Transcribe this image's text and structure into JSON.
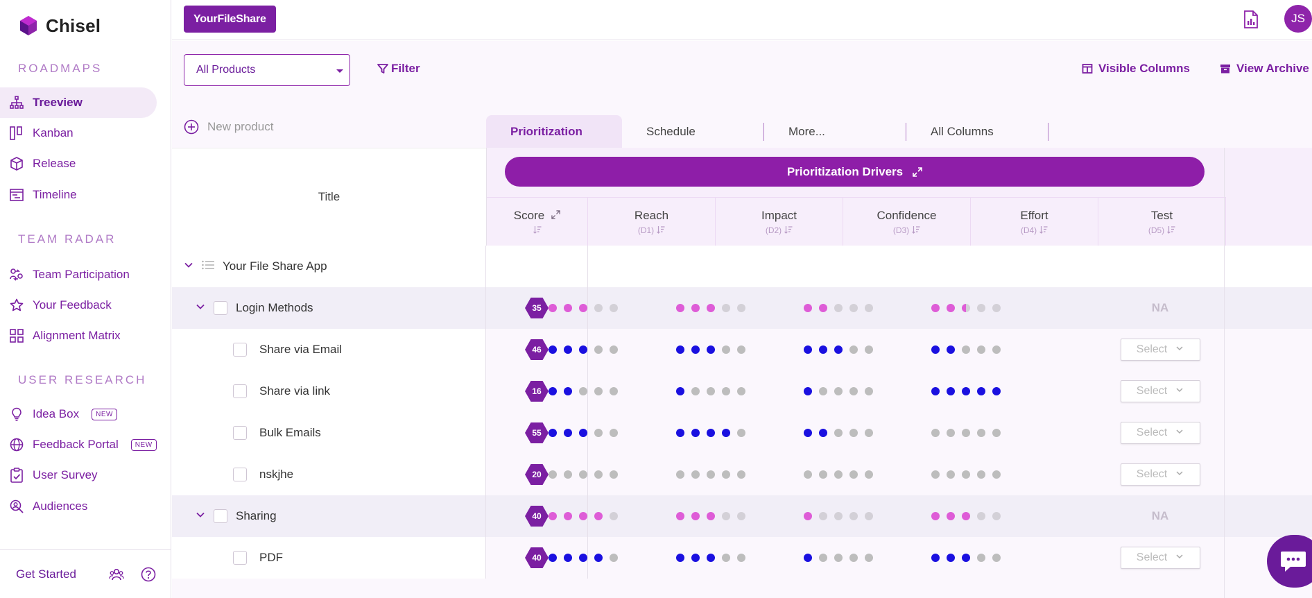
{
  "brand": {
    "name": "Chisel"
  },
  "sidebar": {
    "sections": [
      {
        "title": "ROADMAPS"
      },
      {
        "title": "TEAM RADAR"
      },
      {
        "title": "USER RESEARCH"
      }
    ],
    "roadmaps": [
      {
        "label": "Treeview",
        "icon": "tree-icon",
        "active": true
      },
      {
        "label": "Kanban",
        "icon": "kanban-icon"
      },
      {
        "label": "Release",
        "icon": "box-icon"
      },
      {
        "label": "Timeline",
        "icon": "timeline-icon"
      }
    ],
    "team_radar": [
      {
        "label": "Team Participation",
        "icon": "participation-icon"
      },
      {
        "label": "Your Feedback",
        "icon": "star-icon"
      },
      {
        "label": "Alignment Matrix",
        "icon": "grid-icon"
      }
    ],
    "user_research": [
      {
        "label": "Idea Box",
        "icon": "lightbulb-icon",
        "badge": "NEW"
      },
      {
        "label": "Feedback Portal",
        "icon": "globe-icon",
        "badge": "NEW"
      },
      {
        "label": "User Survey",
        "icon": "clipboard-icon"
      },
      {
        "label": "Audiences",
        "icon": "audience-icon"
      }
    ],
    "bottom": {
      "get_started": "Get Started"
    }
  },
  "topbar": {
    "workspace": "YourFileShare",
    "avatar_initials": "JS"
  },
  "toolbar": {
    "product_select": "All Products",
    "filter": "Filter",
    "visible_columns": "Visible Columns",
    "view_archive": "View Archive"
  },
  "new_product": "New product",
  "tabs": [
    {
      "label": "Prioritization",
      "active": true
    },
    {
      "label": "Schedule"
    },
    {
      "label": "More..."
    },
    {
      "label": "All Columns"
    }
  ],
  "table": {
    "title_header": "Title",
    "drivers_header": "Prioritization Drivers",
    "columns": [
      {
        "label": "Score",
        "sub": ""
      },
      {
        "label": "Reach",
        "sub": "(D1)"
      },
      {
        "label": "Impact",
        "sub": "(D2)"
      },
      {
        "label": "Confidence",
        "sub": "(D3)"
      },
      {
        "label": "Effort",
        "sub": "(D4)"
      },
      {
        "label": "Test",
        "sub": "(D5)"
      }
    ],
    "na_label": "NA",
    "select_label": "Select",
    "rows": [
      {
        "type": "root",
        "title": "Your File Share App"
      },
      {
        "type": "group",
        "title": "Login Methods",
        "score": "35",
        "reach": 3,
        "impact": 3,
        "confidence": 2,
        "effort": 2.5,
        "test": "NA"
      },
      {
        "type": "child",
        "title": "Share via Email",
        "score": "46",
        "reach": 3,
        "impact": 3,
        "confidence": 3,
        "effort": 2,
        "test": "Select"
      },
      {
        "type": "child",
        "title": "Share via link",
        "score": "16",
        "reach": 2,
        "impact": 1,
        "confidence": 1,
        "effort": 5,
        "test": "Select"
      },
      {
        "type": "child",
        "title": "Bulk Emails",
        "score": "55",
        "reach": 3,
        "impact": 4,
        "confidence": 2,
        "effort": 0,
        "test": "Select"
      },
      {
        "type": "child",
        "title": "nskjhe",
        "score": "20",
        "reach": 0,
        "impact": 0,
        "confidence": 0,
        "effort": 0,
        "test": "Select"
      },
      {
        "type": "group",
        "title": "Sharing",
        "score": "40",
        "reach": 4,
        "impact": 3,
        "confidence": 1,
        "effort": 3,
        "test": "NA"
      },
      {
        "type": "child",
        "title": "PDF",
        "score": "40",
        "reach": 4,
        "impact": 3,
        "confidence": 1,
        "effort": 3,
        "test": "Select"
      }
    ]
  },
  "colors": {
    "brand": "#7b1fa2",
    "dot_filled_child": "#1a10e0",
    "dot_filled_group": "#de5cd7",
    "dot_empty": "#bdbdbd"
  }
}
